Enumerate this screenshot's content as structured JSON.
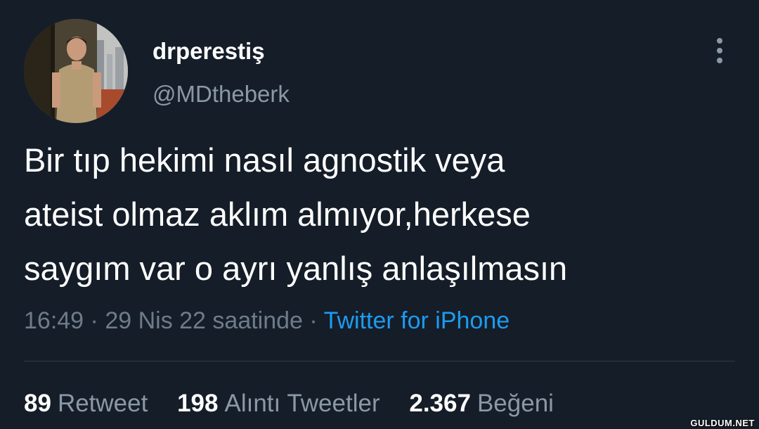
{
  "author": {
    "display_name": "drperestiş",
    "handle": "@MDtheberk"
  },
  "tweet": {
    "lines": [
      "Bir tıp hekimi nasıl agnostik veya",
      "ateist olmaz aklım almıyor,herkese",
      "saygım var o ayrı yanlış anlaşılmasın"
    ],
    "time": "16:49",
    "separator": "·",
    "date": "29 Nis 22 saatinde",
    "source": "Twitter for iPhone"
  },
  "stats": {
    "retweets": {
      "count": "89",
      "label": "Retweet"
    },
    "quotes": {
      "count": "198",
      "label": "Alıntı Tweetler"
    },
    "likes": {
      "count": "2.367",
      "label": "Beğeni"
    }
  },
  "watermark": "GULDUM.NET",
  "icons": {
    "more": "more-vertical-icon"
  },
  "colors": {
    "background": "#151d28",
    "primary_text": "#ffffff",
    "secondary_text": "#8b98a5",
    "link": "#1d9bf0",
    "divider": "#2f3a46"
  }
}
